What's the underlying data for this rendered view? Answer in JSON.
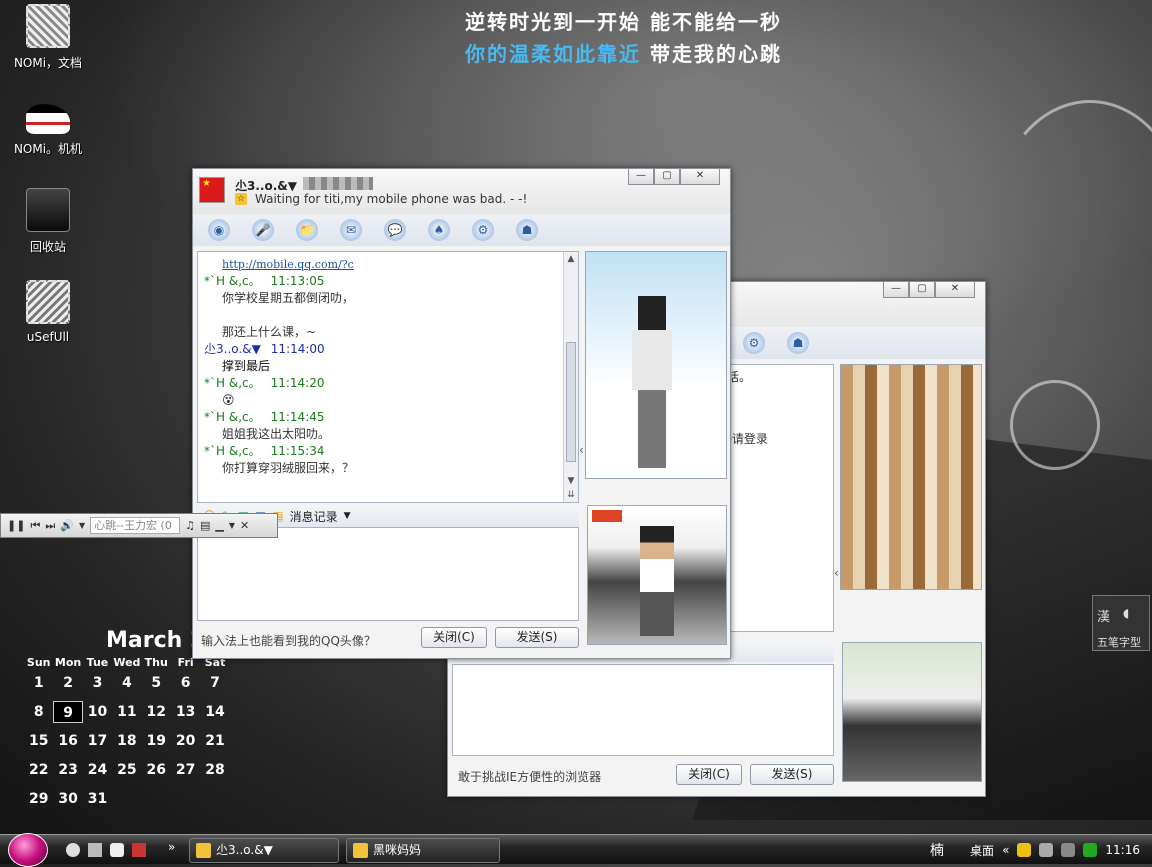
{
  "wallpaper": {
    "lyric_line1": "逆转时光到一开始 能不能给一秒",
    "lyric_line2_blue": "你的温柔如此靠近",
    "lyric_line2_white": "带走我的心跳"
  },
  "desktop_icons": [
    {
      "label": "NOMi，文档",
      "icon": "stamp-icon"
    },
    {
      "label": "NOMi。机机",
      "icon": "sneaker-icon"
    },
    {
      "label": "回收站",
      "icon": "recycle-bin-icon"
    },
    {
      "label": "uSefUll",
      "icon": "stamp-icon"
    }
  ],
  "calendar": {
    "title": "March 20",
    "days": [
      "Sun",
      "Mon",
      "Tue",
      "Wed",
      "Thu",
      "Fri",
      "Sat"
    ],
    "weeks": [
      [
        "1",
        "2",
        "3",
        "4",
        "5",
        "6",
        "7"
      ],
      [
        "8",
        "9",
        "10",
        "11",
        "12",
        "13",
        "14"
      ],
      [
        "15",
        "16",
        "17",
        "18",
        "19",
        "20",
        "21"
      ],
      [
        "22",
        "23",
        "24",
        "25",
        "26",
        "27",
        "28"
      ],
      [
        "29",
        "30",
        "31",
        "",
        "",
        "",
        ""
      ]
    ],
    "today": "9"
  },
  "chat_front": {
    "contact_name": "尐3..o.&▼",
    "signature": "Waiting for titi,my mobile phone was bad. - -!",
    "link_text": "http://mobile.qq.com/?c",
    "messages": [
      {
        "sender": "*`H &,c。",
        "time": "11:13:05",
        "lines": [
          "你学校星期五都倒闭叻，",
          "",
          "那还上什么课，~"
        ],
        "me": false
      },
      {
        "sender": "尐3..o.&▼",
        "time": "11:14:00",
        "lines": [
          "撑到最后"
        ],
        "me": true
      },
      {
        "sender": "*`H &,c。",
        "time": "11:14:20",
        "lines": [
          "😵"
        ],
        "me": false
      },
      {
        "sender": "*`H &,c。",
        "time": "11:14:45",
        "lines": [
          "姐姐我这出太阳叻。"
        ],
        "me": false
      },
      {
        "sender": "*`H &,c。",
        "time": "11:15:34",
        "lines": [
          "你打算穿羽绒服回来，？"
        ],
        "me": false
      }
    ],
    "history_label": "消息记录",
    "tip": "输入法上也能看到我的QQ头像？",
    "close_label": "关闭(C)",
    "send_label": "发送(S)"
  },
  "chat_back": {
    "partial_line1": "生电话。",
    "partial_line2": "QQ请登录",
    "tip": "敢于挑战IE方便性的浏览器",
    "close_label": "关闭(C)",
    "send_label": "发送(S)"
  },
  "media_player": {
    "track": "心跳--王力宏 (0"
  },
  "ime": {
    "char": "漢",
    "mode": "五笔字型"
  },
  "taskbar": {
    "tasks": [
      "尐3..o.&▼",
      "黑咪妈妈"
    ],
    "desktop_label": "桌面",
    "clock": "11:16",
    "ime_char": "楠"
  },
  "colors": {
    "lyric_blue": "#49b9f2",
    "sender_green": "#1b7a1b",
    "sender_blue": "#1d2fa8"
  }
}
